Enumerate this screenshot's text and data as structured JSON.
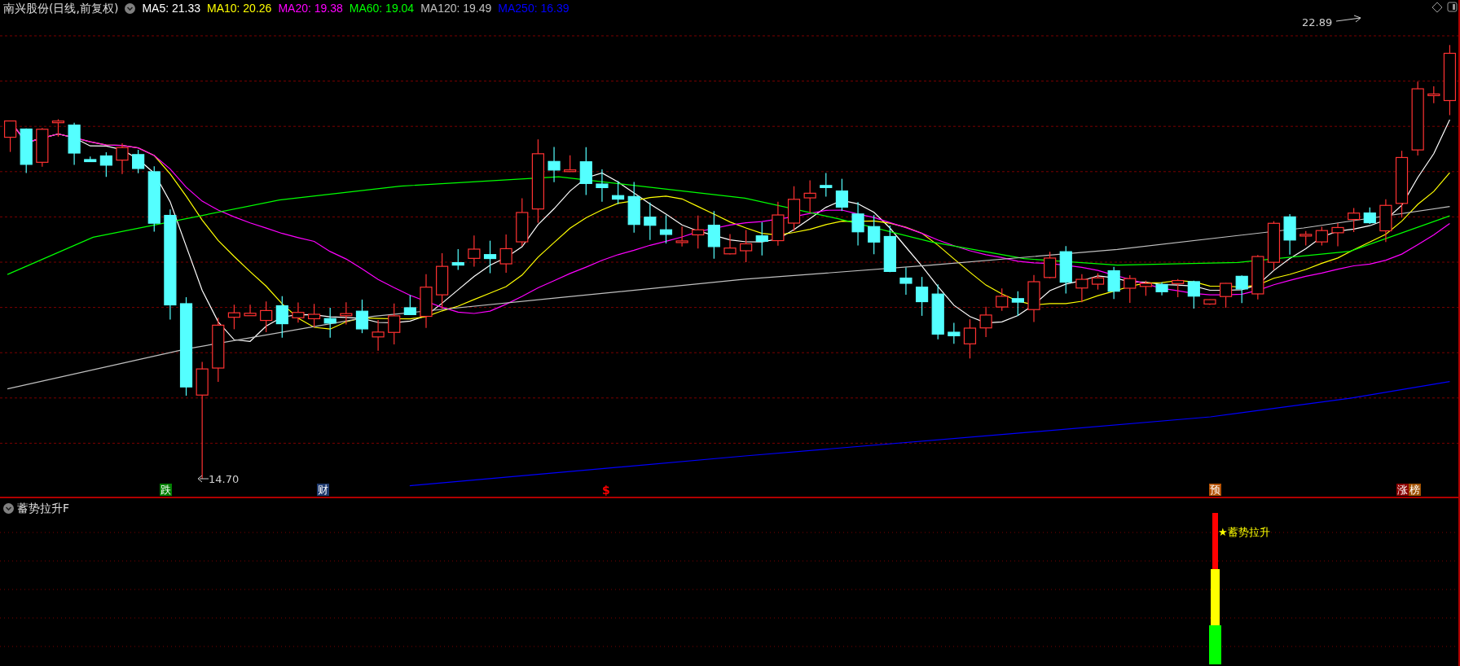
{
  "main_panel": {
    "title": "南兴股份(日线,前复权)",
    "moving_averages": [
      {
        "label": "MA5:",
        "value": "21.33",
        "color": "#ffffff"
      },
      {
        "label": "MA10:",
        "value": "20.26",
        "color": "#ffff00"
      },
      {
        "label": "MA20:",
        "value": "19.38",
        "color": "#ff00ff"
      },
      {
        "label": "MA60:",
        "value": "19.04",
        "color": "#00ff00"
      },
      {
        "label": "MA120:",
        "value": "19.49",
        "color": "#c0c0c0"
      },
      {
        "label": "MA250:",
        "value": "16.39",
        "color": "#0000ff"
      }
    ],
    "high_label": "22.89",
    "low_label": "14.70",
    "event_markers": [
      {
        "kind": "badge",
        "text": "跌",
        "color": "#007f00"
      },
      {
        "kind": "badge",
        "text": "财",
        "color": "#1f3a6e"
      },
      {
        "kind": "sign",
        "text": "$",
        "color": "#ff0000"
      },
      {
        "kind": "badge",
        "text": "预",
        "color": "#b45000"
      },
      {
        "kind": "badge",
        "text": "涨",
        "color": "#8b0000"
      },
      {
        "kind": "badge",
        "text": "榜",
        "color": "#a05000"
      }
    ]
  },
  "indicator_panel": {
    "title": "蓄势拉升F",
    "signal_label": "★蓄势拉升"
  }
}
